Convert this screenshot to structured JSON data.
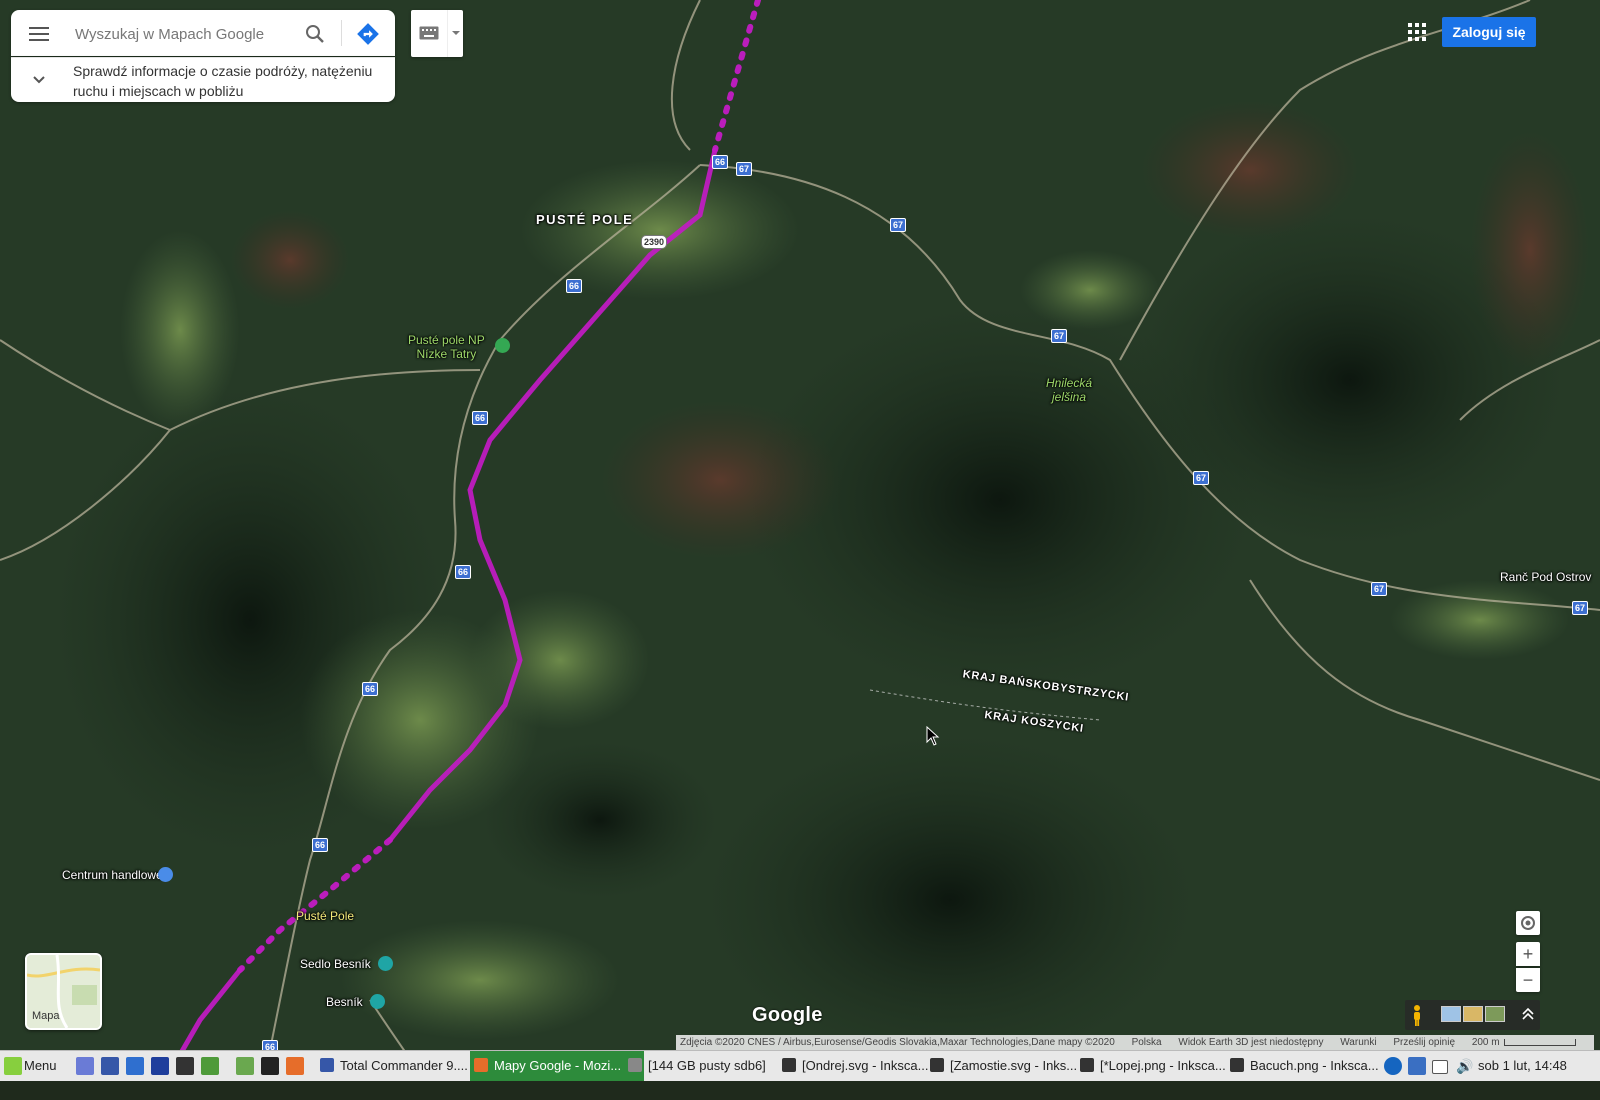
{
  "search": {
    "placeholder": "Wyszukaj w Mapach Google",
    "info_text": "Sprawdź informacje o czasie podróży, natężeniu ruchu i miejscach w pobliżu"
  },
  "header": {
    "login_label": "Zaloguj się"
  },
  "map": {
    "place_labels": {
      "puste_pole_town": "PUSTÉ POLE",
      "np_label_line1": "Pusté pole NP",
      "np_label_line2": "Nízke Tatry",
      "hnilecka_line1": "Hnilecká",
      "hnilecka_line2": "jelšina",
      "ranc": "Ranč Pod Ostrov",
      "kraj_bb": "KRAJ BAŃSKOBYSTRZYCKI",
      "kraj_ko": "KRAJ KOSZYCKI",
      "centrum": "Centrum handlowe",
      "puste_pole_small": "Pusté Pole",
      "sedlo": "Sedlo Besník",
      "besnik": "Besník"
    },
    "road_numbers": {
      "r66": "66",
      "r67": "67",
      "r2390": "2390"
    },
    "map_type_label": "Mapa",
    "logo": "Google",
    "footer": {
      "attribution": "Zdjęcia ©2020 CNES / Airbus,Eurosense/Geodis Slovakia,Maxar Technologies,Dane mapy ©2020",
      "country": "Polska",
      "earth": "Widok Earth 3D jest niedostępny",
      "terms": "Warunki",
      "feedback": "Prześlij opinię",
      "scale": "200 m"
    },
    "colors": {
      "route": "#c21bc4",
      "road_shield": "#3d6fd1",
      "login_button": "#1a73e8"
    }
  },
  "taskbar": {
    "menu_label": "Menu",
    "windows": [
      "Total Commander 9....",
      "Mapy Google - Mozi...",
      "[144 GB pusty sdb6]",
      "[Ondrej.svg - Inksca...",
      "[Zamostie.svg - Inks...",
      "[*Lopej.png - Inksca...",
      "Bacuch.png - Inksca..."
    ],
    "clock": "sob  1 lut, 14:48"
  }
}
